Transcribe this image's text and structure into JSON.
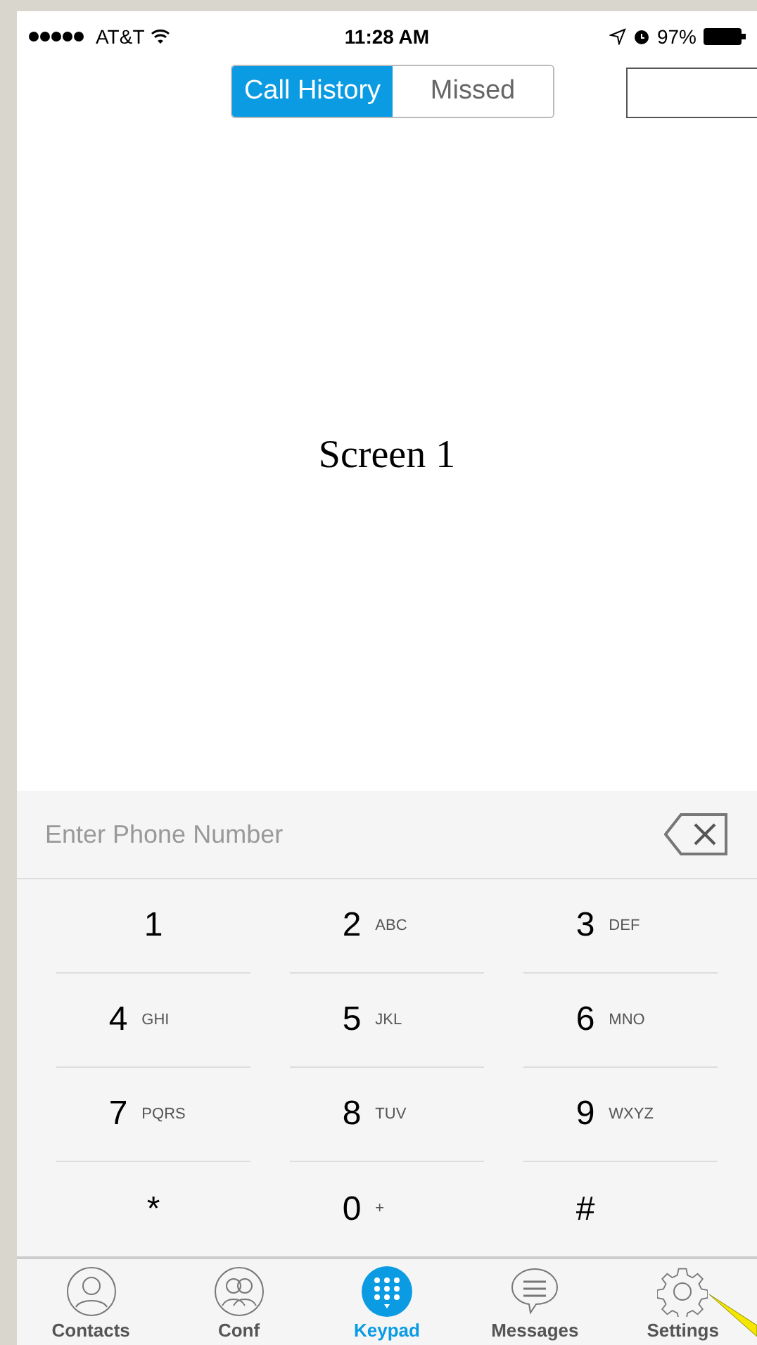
{
  "status_bar": {
    "carrier": "AT&T",
    "time": "11:28 AM",
    "battery": "97%"
  },
  "segments": [
    {
      "label": "Call History",
      "selected": true
    },
    {
      "label": "Missed",
      "selected": false
    }
  ],
  "caption": "Screen 1",
  "phone_field": {
    "placeholder": "Enter Phone Number"
  },
  "keys": [
    {
      "digit": "1"
    },
    {
      "digit": "2",
      "letters": "ABC"
    },
    {
      "digit": "3",
      "letters": "DEF"
    },
    {
      "digit": "4",
      "letters": "GHI"
    },
    {
      "digit": "5",
      "letters": "JKL"
    },
    {
      "digit": "6",
      "letters": "MNO"
    },
    {
      "digit": "7",
      "letters": "PQRS"
    },
    {
      "digit": "8",
      "letters": "TUV"
    },
    {
      "digit": "9",
      "letters": "WXYZ"
    },
    {
      "digit": "*"
    },
    {
      "digit": "0",
      "letters": "+"
    },
    {
      "digit": "#"
    }
  ],
  "tabs": [
    {
      "label": "Contacts",
      "kind": "person",
      "selected": false
    },
    {
      "label": "Conf",
      "kind": "group",
      "selected": false
    },
    {
      "label": "Keypad",
      "kind": "keypad",
      "selected": true
    },
    {
      "label": "Messages",
      "kind": "chat",
      "selected": false
    },
    {
      "label": "Settings",
      "kind": "gear",
      "selected": false
    }
  ]
}
